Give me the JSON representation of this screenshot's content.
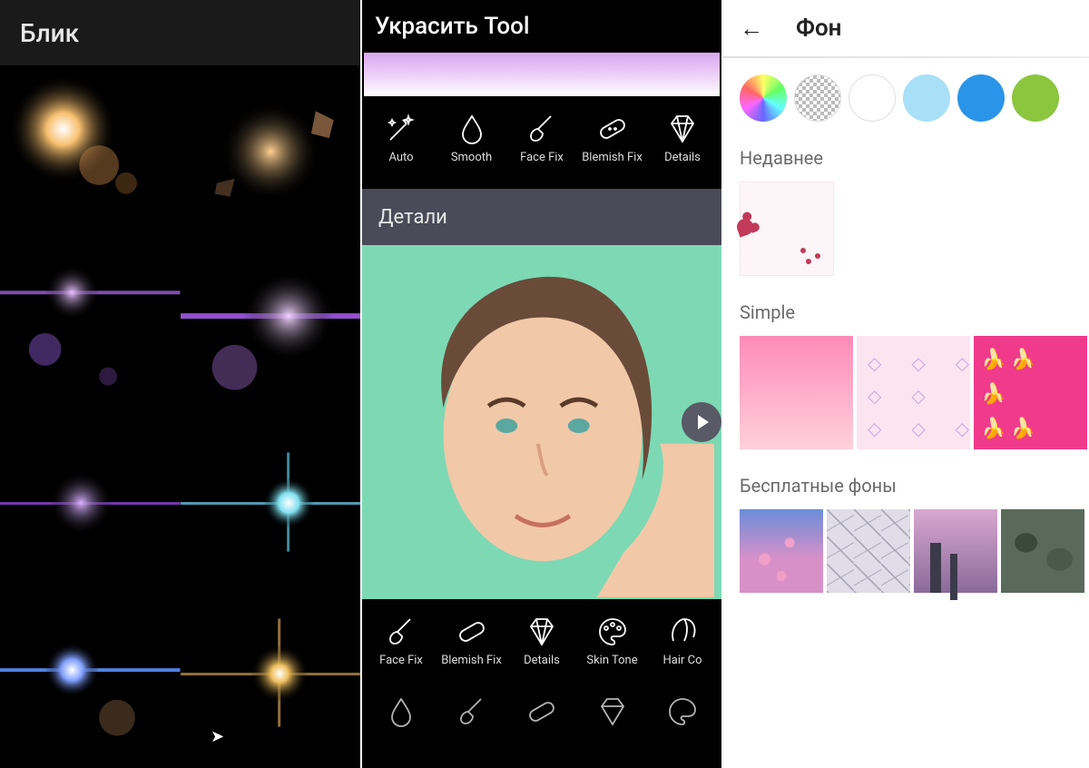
{
  "panel1": {
    "title": "Блик",
    "flares": [
      "orange-flare-1",
      "orange-flare-2",
      "purple-flare-1",
      "purple-flare-2",
      "purple-flare-3",
      "cyan-flare",
      "blue-flare",
      "gold-flare"
    ]
  },
  "panel2": {
    "title": "Украсить Tool",
    "tools_top": [
      {
        "icon": "auto",
        "label": "Auto"
      },
      {
        "icon": "smooth",
        "label": "Smooth"
      },
      {
        "icon": "facefix",
        "label": "Face Fix"
      },
      {
        "icon": "blemish",
        "label": "Blemish Fix"
      },
      {
        "icon": "details",
        "label": "Details"
      }
    ],
    "section_label": "Детали",
    "tools_bottom": [
      {
        "icon": "facefix",
        "label": "Face Fix"
      },
      {
        "icon": "blemish",
        "label": "Blemish Fix"
      },
      {
        "icon": "details",
        "label": "Details"
      },
      {
        "icon": "skintone",
        "label": "Skin Tone"
      },
      {
        "icon": "haircolor",
        "label": "Hair Co"
      }
    ]
  },
  "panel3": {
    "title": "Фон",
    "colors": [
      "rainbow",
      "transparent",
      "white",
      "lightblue",
      "blue",
      "green"
    ],
    "section_recent": "Недавнее",
    "section_simple": "Simple",
    "section_free": "Бесплатные фоны"
  }
}
